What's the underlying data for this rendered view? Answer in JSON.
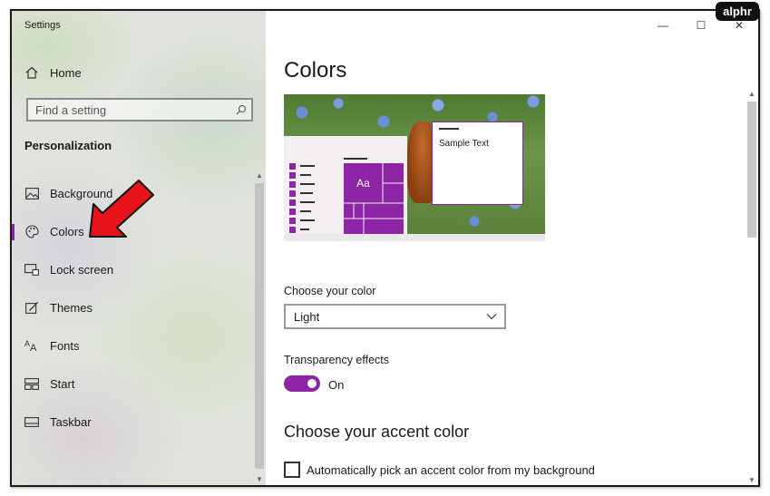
{
  "app": {
    "title": "Settings"
  },
  "window_controls": {
    "minimize": "—",
    "maximize": "☐",
    "close": "✕"
  },
  "sidebar": {
    "home_label": "Home",
    "search_placeholder": "Find a setting",
    "section_heading": "Personalization",
    "items": [
      {
        "label": "Background",
        "icon": "picture-icon"
      },
      {
        "label": "Colors",
        "icon": "palette-icon",
        "selected": true
      },
      {
        "label": "Lock screen",
        "icon": "lock-screen-icon"
      },
      {
        "label": "Themes",
        "icon": "themes-brush-icon"
      },
      {
        "label": "Fonts",
        "icon": "fonts-icon"
      },
      {
        "label": "Start",
        "icon": "start-menu-icon"
      },
      {
        "label": "Taskbar",
        "icon": "taskbar-icon"
      }
    ]
  },
  "main": {
    "page_title": "Colors",
    "preview": {
      "tile_label": "Aa",
      "sample_text": "Sample Text"
    },
    "choose_color_label": "Choose your color",
    "choose_color_value": "Light",
    "transparency_label": "Transparency effects",
    "transparency_state": "On",
    "accent_heading": "Choose your accent color",
    "auto_accent_label": "Automatically pick an accent color from my background"
  },
  "colors": {
    "accent": "#8e24a6",
    "callout_arrow": "#e8121a"
  },
  "watermark": "alphr"
}
